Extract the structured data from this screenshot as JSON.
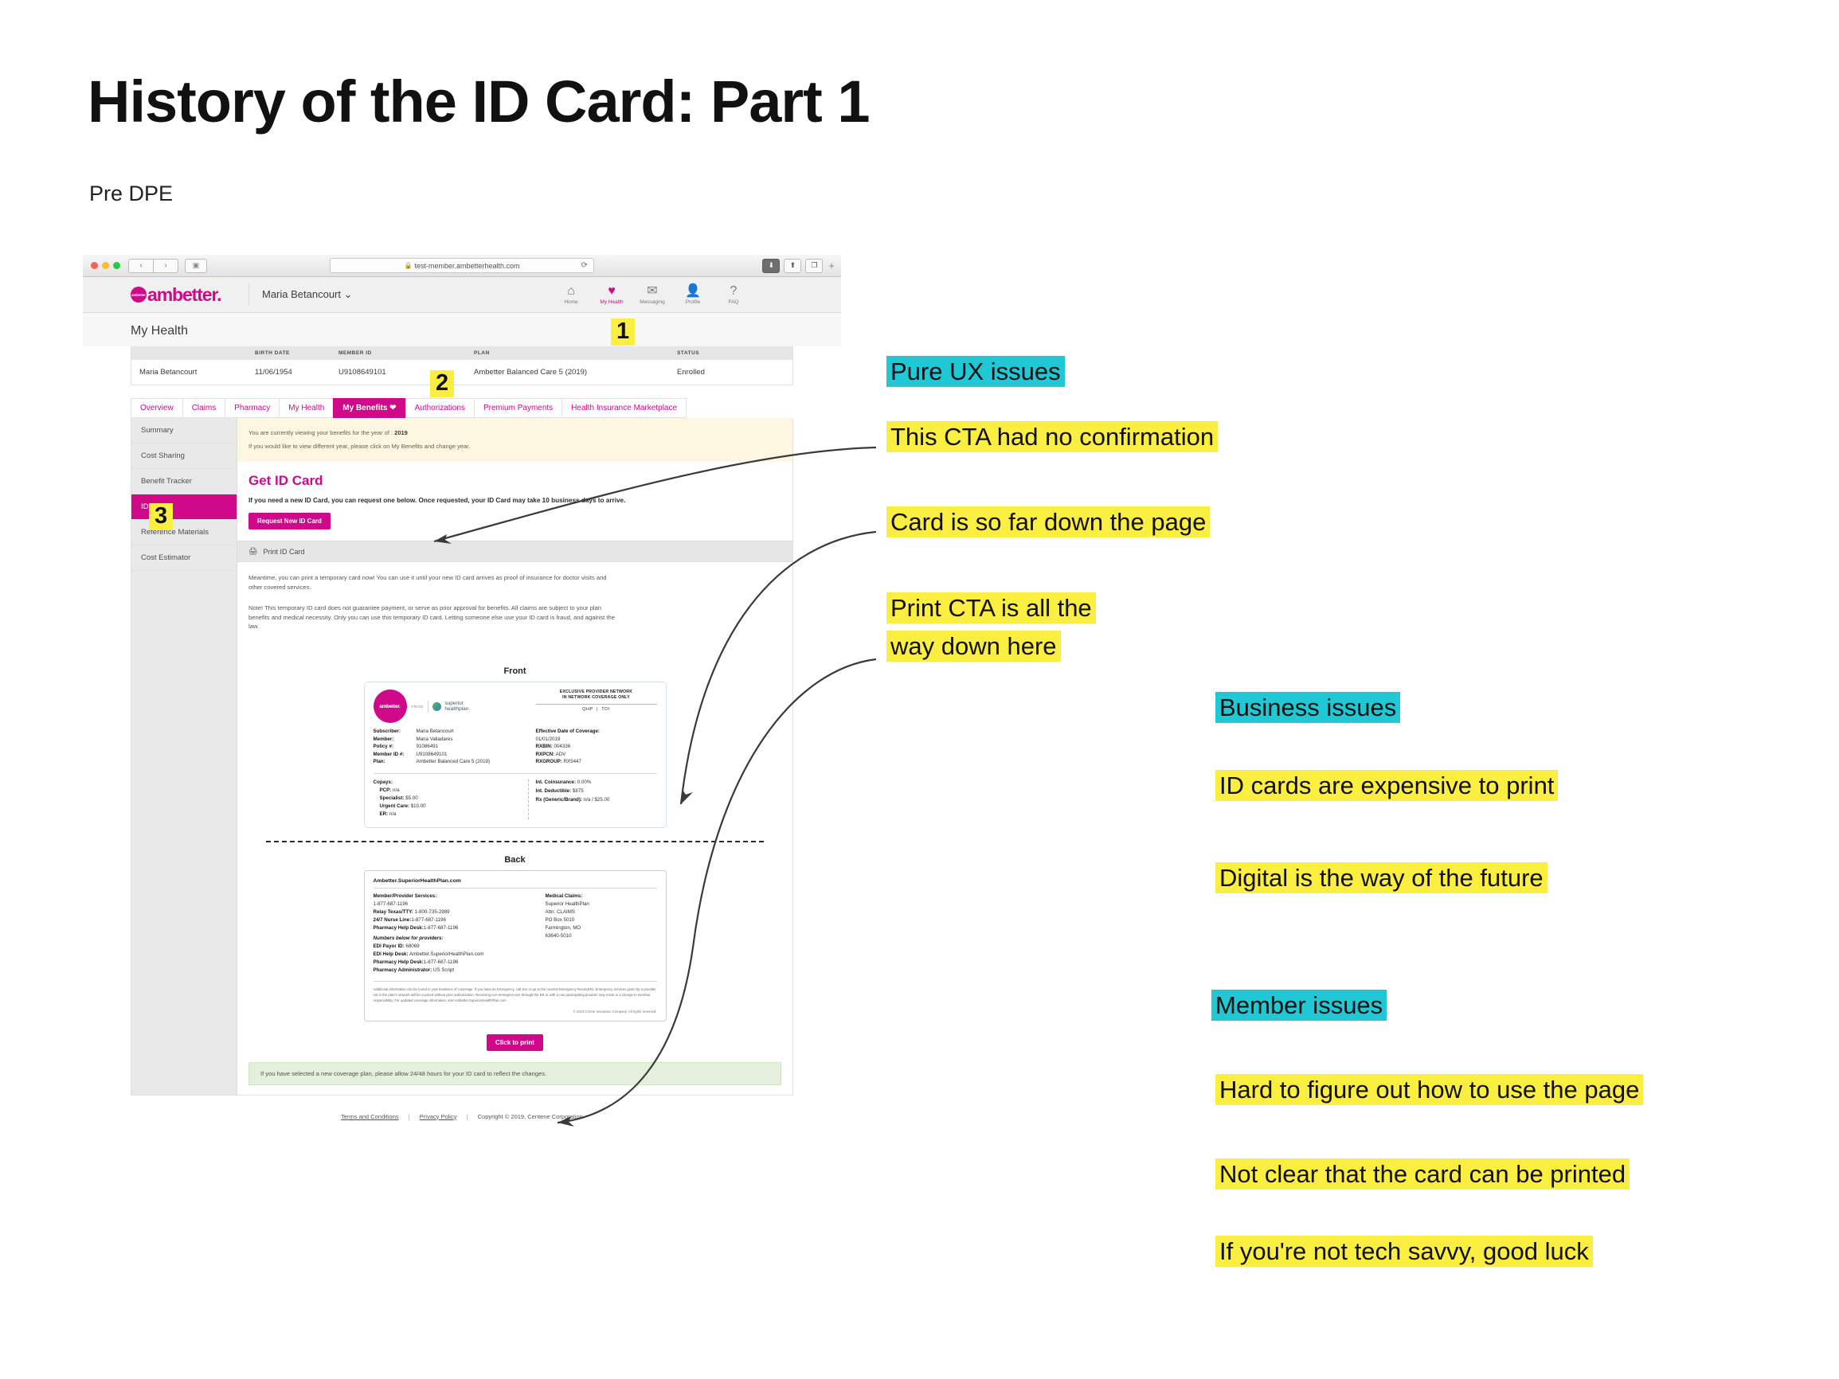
{
  "slide": {
    "title": "History of the ID Card: Part 1",
    "subtitle": "Pre DPE"
  },
  "markers": [
    {
      "id": "1",
      "label": "1"
    },
    {
      "id": "2",
      "label": "2"
    },
    {
      "id": "3",
      "label": "3"
    }
  ],
  "browser": {
    "url": "test-member.ambetterhealth.com",
    "lock_icon": "lock-icon",
    "reload_icon": "reload-icon",
    "back_label": "‹",
    "forward_label": "›",
    "sidebar_toggle": "▣",
    "download_icon": "⬇",
    "share_icon": "⬆",
    "tabs_icon": "❐",
    "new_tab": "+"
  },
  "site": {
    "brand_mark_text": "ambetter",
    "brand_word": "ambetter.",
    "user_name": "Maria Betancourt ⌄",
    "nav": [
      {
        "label": "Home",
        "icon": "home-icon",
        "glyph": "⌂",
        "active": false
      },
      {
        "label": "My Health",
        "icon": "heart-icon",
        "glyph": "♥",
        "active": true
      },
      {
        "label": "Messaging",
        "icon": "envelope-icon",
        "glyph": "✉",
        "active": false
      },
      {
        "label": "Profile",
        "icon": "person-icon",
        "glyph": "👤",
        "active": false
      },
      {
        "label": "FAQ",
        "icon": "question-icon",
        "glyph": "?",
        "active": false
      }
    ],
    "page_title": "My Health",
    "member_table": {
      "headers": [
        "",
        "BIRTH DATE",
        "MEMBER ID",
        "PLAN",
        "STATUS"
      ],
      "row": [
        "Maria Betancourt",
        "11/06/1954",
        "U9108649101",
        "Ambetter Balanced Care 5 (2019)",
        "Enrolled"
      ]
    },
    "tabs": [
      {
        "label": "Overview",
        "active": false
      },
      {
        "label": "Claims",
        "active": false
      },
      {
        "label": "Pharmacy",
        "active": false
      },
      {
        "label": "My Health",
        "active": false
      },
      {
        "label": "My Benefits ❤",
        "active": true
      },
      {
        "label": "Authorizations",
        "active": false
      },
      {
        "label": "Premium Payments",
        "active": false
      },
      {
        "label": "Health Insurance Marketplace",
        "active": false
      }
    ],
    "sidebar": [
      {
        "label": "Summary",
        "active": false
      },
      {
        "label": "Cost Sharing",
        "active": false
      },
      {
        "label": "Benefit Tracker",
        "active": false
      },
      {
        "label": "ID Card",
        "active": true
      },
      {
        "label": "Reference Materials",
        "active": false
      },
      {
        "label": "Cost Estimator",
        "active": false
      }
    ],
    "notice_line1_pre": "You are currently viewing your benefits for the year of : ",
    "notice_year": "2019",
    "notice_line2": "If you would like to view different year, please click on My Benefits and change year.",
    "get_id": {
      "heading": "Get ID Card",
      "body": "If you need a new ID Card, you can request one below. Once requested, your ID Card may take 10 business days to arrive.",
      "button": "Request New ID Card"
    },
    "print_bar": {
      "icon": "printer-icon",
      "label": "Print ID Card"
    },
    "body_p1": "Meantime, you can print a temporary card now! You can use it until your new ID card arrives as proof of insurance for doctor visits and other covered services.",
    "body_p2": "Note! This temporary ID card does not guarantee payment, or serve as prior approval for benefits. All claims are subject to your plan benefits and medical necessity. Only you can use this temporary ID card. Letting someone else use your ID card is fraud, and against the law.",
    "card_front": {
      "label": "Front",
      "logo_text": "ambetter.",
      "from_label": "FROM",
      "partner_line1": "superior",
      "partner_line2": "healthplan.",
      "network_line1": "EXCLUSIVE PROVIDER NETWORK",
      "network_line2": "IN NETWORK COVERAGE ONLY",
      "qhp": "QHP",
      "tdi": "TDI",
      "fields": [
        {
          "key": "Subscriber:",
          "value": "Maria Betancourt"
        },
        {
          "key": "Member:",
          "value": "Maria Valladares"
        },
        {
          "key": "Policy #:",
          "value": "91086491"
        },
        {
          "key": "Member ID #:",
          "value": "U9108649101"
        },
        {
          "key": "Plan:",
          "value": "Ambetter Balanced Care 5 (2019)"
        }
      ],
      "right_fields": [
        {
          "key": "Effective Date of Coverage:",
          "value": ""
        },
        {
          "key": "",
          "value": "01/01/2019"
        },
        {
          "key": "RXBIN:",
          "value": "004336"
        },
        {
          "key": "RXPCN:",
          "value": "ADV"
        },
        {
          "key": "RXGROUP:",
          "value": "RX5447"
        }
      ],
      "copays_heading": "Copays:",
      "copays": [
        {
          "key": "PCP:",
          "value": "n/a"
        },
        {
          "key": "Specialist:",
          "value": "$5.00"
        },
        {
          "key": "Urgent Care:",
          "value": "$10.00"
        },
        {
          "key": "ER:",
          "value": "n/a"
        }
      ],
      "copays_right": [
        {
          "key": "Int. Coinsurance:",
          "value": "0.00%"
        },
        {
          "key": "Int. Deductible:",
          "value": "$875"
        },
        {
          "key": "Rx (Generic/Brand):",
          "value": "n/a / $25.00"
        }
      ]
    },
    "card_back": {
      "label": "Back",
      "url": "Ambetter.SuperiorHealthPlan.com",
      "left": [
        {
          "key": "Member/Provider Services:",
          "value": ""
        },
        {
          "key": "",
          "value": "1-877-687-1196"
        },
        {
          "key": "Relay Texas/TTY:",
          "value": " 1-800-735-2989"
        },
        {
          "key": "24/7 Nurse Line:",
          "value": "1-877-687-1196"
        },
        {
          "key": "Pharmacy Help Desk:",
          "value": "1-877-687-1196"
        }
      ],
      "providers_heading": "Numbers below for providers:",
      "left2": [
        {
          "key": "EDI Payor ID:",
          "value": " 68069"
        },
        {
          "key": "EDI Help Desk:",
          "value": " Ambetter.SuperiorHealthPlan.com"
        },
        {
          "key": "Pharmacy Help Desk:",
          "value": "1-877-687-1196"
        },
        {
          "key": "Pharmacy Administrator:",
          "value": " US Script"
        }
      ],
      "right_heading": "Medical Claims:",
      "right": [
        "Superior HealthPlan",
        "Attn: CLAIMS",
        "PO Box 5010",
        "Farmington, MO",
        "63640-5010"
      ],
      "fine_print": "Additional information can be found in your Evidence of Coverage. If you have an Emergency, call 911 or go to the nearest Emergency Room(ER). Emergency services given by a provider not in the plan's network will be covered without prior authorization. Receiving non-emergent care through the ER or with a non participating provider may result in a change to member responsibility. For updated coverage information, visit Ambetter.SuperiorHealthPlan.com.",
      "copyright": "© 2015 Centre Insurance Company. All rights reserved."
    },
    "print_button": "Click to print",
    "green_notice": "If you have selected a new coverage plan, please allow 24/48 hours for your ID card to reflect the changes.",
    "footer": {
      "terms": "Terms and Conditions",
      "privacy": "Privacy Policy",
      "copyright": "Copyright © 2019, Centene Corporation",
      "sep": "|"
    }
  },
  "annotations": {
    "ux_heading": "Pure UX issues",
    "ux_items": [
      "This CTA had no confirmation",
      "Card is so far down the page",
      "Print CTA is all the way down here"
    ],
    "business_heading": "Business issues",
    "business_items": [
      "ID cards are expensive to print",
      "Digital is the way of the future"
    ],
    "member_heading": "Member issues",
    "member_items": [
      "Hard to figure out how to use the page",
      "Not clear that the card can be printed",
      "If you're not tech savvy, good luck"
    ]
  },
  "colors": {
    "highlight_yellow": "#FAEE41",
    "highlight_cyan": "#1FC8D4",
    "brand_magenta": "#CF0989"
  }
}
